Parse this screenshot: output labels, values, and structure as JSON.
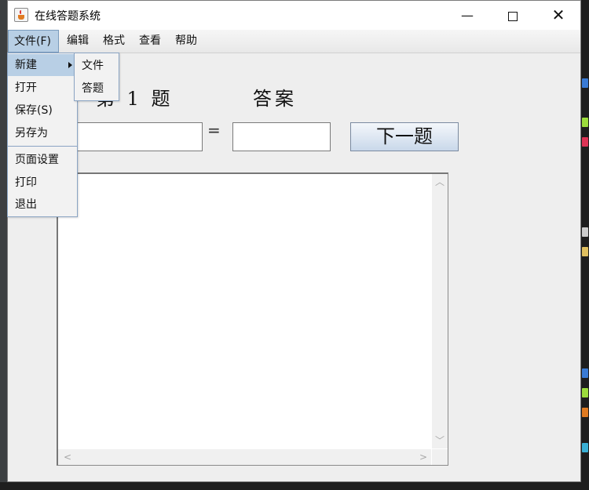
{
  "window": {
    "title": "在线答题系统",
    "controls": {
      "minimize": "—",
      "close": "✕"
    }
  },
  "menubar": {
    "items": [
      {
        "label": "文件(F)"
      },
      {
        "label": "编辑"
      },
      {
        "label": "格式"
      },
      {
        "label": "查看"
      },
      {
        "label": "帮助"
      }
    ]
  },
  "file_menu": {
    "items": [
      {
        "label": "新建"
      },
      {
        "label": "打开"
      },
      {
        "label": "保存(S)"
      },
      {
        "label": "另存为"
      },
      {
        "label": "页面设置"
      },
      {
        "label": "打印"
      },
      {
        "label": "退出"
      }
    ],
    "submenu": [
      {
        "label": "文件"
      },
      {
        "label": "答题"
      }
    ]
  },
  "quiz": {
    "question_label": "第 1 题",
    "equals": "=",
    "answer_label": "答案",
    "question_value": "",
    "answer_value": "",
    "next_button": "下一题"
  },
  "scrollbars": {
    "up": "︿",
    "down": "﹀",
    "left": "<",
    "right": ">"
  },
  "colors": {
    "menu_highlight": "#b8cfe5",
    "button_gradient_bottom": "#c9d8ea",
    "window_bg": "#eeeeee"
  }
}
